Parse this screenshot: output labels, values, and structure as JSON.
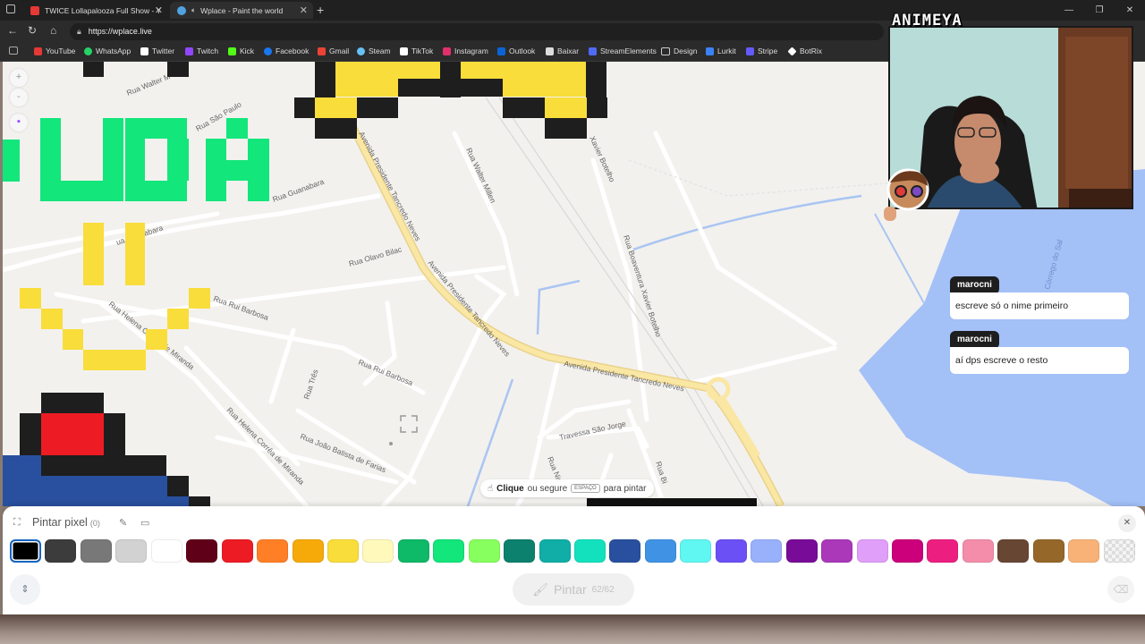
{
  "browser": {
    "tabs": [
      {
        "title": "TWICE Lollapalooza Full Show - Y",
        "icon_color": "#e53935",
        "active": false
      },
      {
        "title": "Wplace - Paint the world",
        "icon_color": "#4fa3e0",
        "active": true
      }
    ],
    "url": "https://wplace.live",
    "bookmarks": [
      {
        "label": "YouTube",
        "color": "#e53935"
      },
      {
        "label": "WhatsApp",
        "color": "#25d366"
      },
      {
        "label": "Twitter",
        "color": "#ffffff"
      },
      {
        "label": "Twitch",
        "color": "#9146ff"
      },
      {
        "label": "Kick",
        "color": "#53fc18"
      },
      {
        "label": "Facebook",
        "color": "#1877f2"
      },
      {
        "label": "Gmail",
        "color": "#ea4335"
      },
      {
        "label": "Steam",
        "color": "#66c0f4"
      },
      {
        "label": "TikTok",
        "color": "#ffffff"
      },
      {
        "label": "Instagram",
        "color": "#e1306c"
      },
      {
        "label": "Outlook",
        "color": "#0a64d6"
      },
      {
        "label": "Baixar",
        "color": "#dddddd"
      },
      {
        "label": "StreamElements",
        "color": "#4f6bf5"
      },
      {
        "label": "Design",
        "color": "#cccccc"
      },
      {
        "label": "Lurkit",
        "color": "#3b82f6"
      },
      {
        "label": "Stripe",
        "color": "#635bff"
      },
      {
        "label": "BotRix",
        "color": "#ffffff"
      }
    ]
  },
  "map": {
    "roads": {
      "walter": "Rua Walter M",
      "sao_paulo": "Rua São Paulo",
      "guanabara": "Rua Guanabara",
      "guanabara2": "ua Guanabara",
      "olavo": "Rua Olavo Bilac",
      "rui1": "Rua Rui Barbosa",
      "rui2": "Rua Rui Barbosa",
      "helena1": "Rua Helena Corrêa de Miranda",
      "helena2": "Rua Helena Corrêa de Miranda",
      "tres": "Rua Três",
      "joao": "Rua João Batista de Farias",
      "tancredo1": "Avenida Presidente Tancredo Neves",
      "tancredo2": "Avenida Presidente Tancredo Neves",
      "tancredo3": "Avenida Presidente Tancredo Neves",
      "walter_millen": "Rua Walter Millen",
      "xavier": "Xavier Botelho",
      "boaventura": "Rua Boaventura Xavier Botelho",
      "travessa": "Travessa São Jorge",
      "nic": "Rua Nic",
      "bi": "Rua Bi",
      "water_text": "Córrego do Sal"
    },
    "hint": {
      "bold": "Clique",
      "mid": "ou segure",
      "key": "ESPAÇO",
      "end": "para pintar"
    }
  },
  "webcam": {
    "logo": "ANIMEYA"
  },
  "chat": [
    {
      "user": "marocni",
      "message": "escreve só o nime primeiro"
    },
    {
      "user": "marocni",
      "message": "aí dps escreve o resto"
    }
  ],
  "panel": {
    "title": "Pintar pixel",
    "count": "(0)",
    "paint_label": "Pintar",
    "paint_count": "62/62",
    "selected_color": "#000000",
    "colors": [
      "#000000",
      "#3c3c3c",
      "#787878",
      "#d2d2d2",
      "#ffffff",
      "#600018",
      "#ed1c24",
      "#ff7f27",
      "#f6aa09",
      "#f9dd3b",
      "#fffabc",
      "#0eb968",
      "#13e67b",
      "#87ff5e",
      "#0c816e",
      "#10aea6",
      "#13e1be",
      "#28509e",
      "#4093e4",
      "#60f7f2",
      "#6b50f6",
      "#99b1fb",
      "#780c99",
      "#aa38b9",
      "#e09ff9",
      "#cb007a",
      "#ec1f80",
      "#f38da9",
      "#684634",
      "#95682a",
      "#f8b277",
      "transparent"
    ]
  }
}
